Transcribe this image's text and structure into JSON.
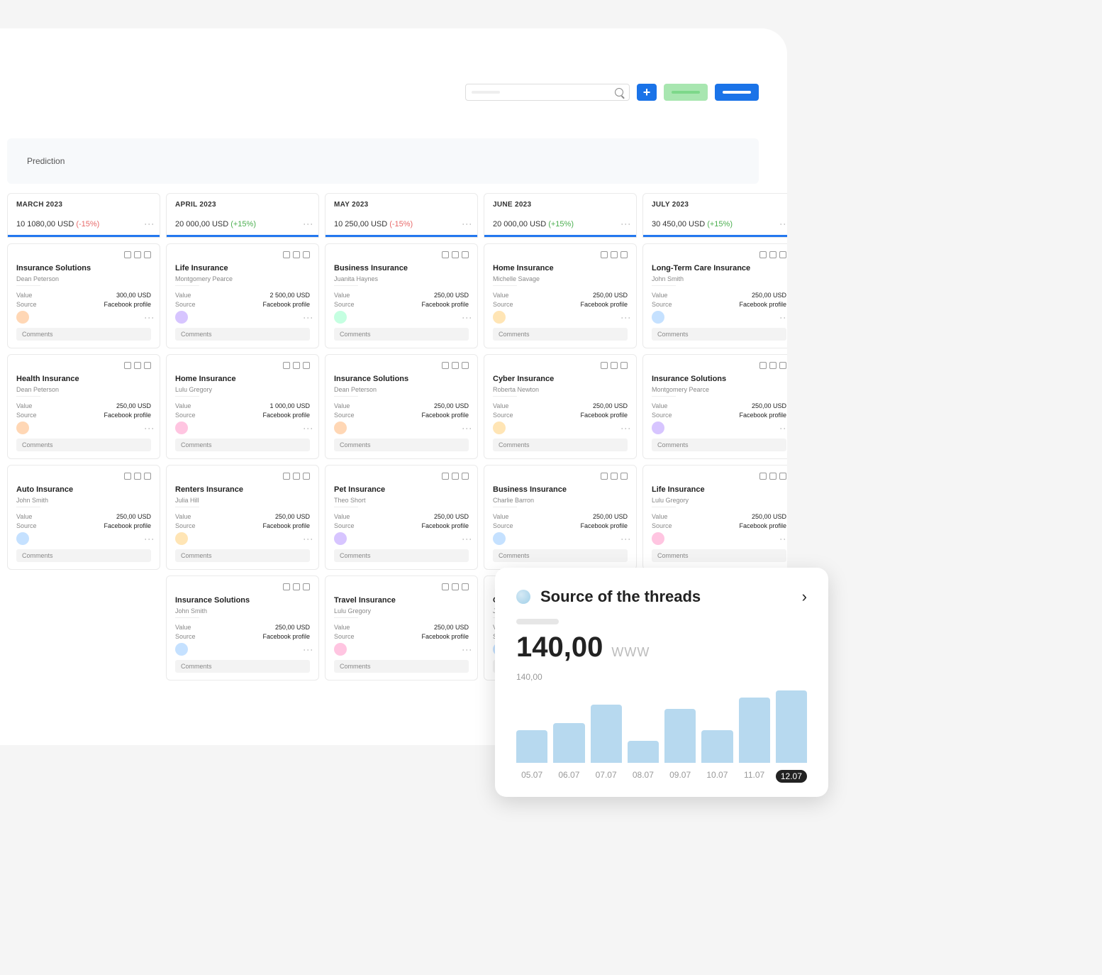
{
  "header": {
    "search_placeholder": "",
    "add_label": "+"
  },
  "tab": {
    "label": "Prediction"
  },
  "labels": {
    "value": "Value",
    "source": "Source",
    "comments": "Comments"
  },
  "columns": [
    {
      "month": "MARCH 2023",
      "amount": "10 1080,00 USD",
      "pct": "(-15%)",
      "pct_dir": "neg",
      "cards": [
        {
          "title": "Insurance Solutions",
          "person": "Dean Peterson",
          "value": "300,00 USD",
          "source": "Facebook profile",
          "avatar": "#ffd7b5"
        },
        {
          "title": "Health Insurance",
          "person": "Dean Peterson",
          "value": "250,00 USD",
          "source": "Facebook profile",
          "avatar": "#ffd7b5"
        },
        {
          "title": "Auto Insurance",
          "person": "John Smith",
          "value": "250,00 USD",
          "source": "Facebook profile",
          "avatar": "#c5e1ff"
        }
      ]
    },
    {
      "month": "APRIL 2023",
      "amount": "20 000,00 USD",
      "pct": "(+15%)",
      "pct_dir": "pos",
      "cards": [
        {
          "title": "Life Insurance",
          "person": "Montgomery Pearce",
          "value": "2 500,00 USD",
          "source": "Facebook profile",
          "avatar": "#d7c5ff"
        },
        {
          "title": "Home Insurance",
          "person": "Lulu Gregory",
          "value": "1 000,00 USD",
          "source": "Facebook profile",
          "avatar": "#ffc5e1"
        },
        {
          "title": "Renters Insurance",
          "person": "Julia Hill",
          "value": "250,00 USD",
          "source": "Facebook profile",
          "avatar": "#ffe5b5"
        },
        {
          "title": "Insurance Solutions",
          "person": "John Smith",
          "value": "250,00 USD",
          "source": "Facebook profile",
          "avatar": "#c5e1ff"
        }
      ]
    },
    {
      "month": "MAY 2023",
      "amount": "10 250,00 USD",
      "pct": "(-15%)",
      "pct_dir": "neg",
      "cards": [
        {
          "title": "Business Insurance",
          "person": "Juanita Haynes",
          "value": "250,00 USD",
          "source": "Facebook profile",
          "avatar": "#c5ffe1"
        },
        {
          "title": "Insurance Solutions",
          "person": "Dean Peterson",
          "value": "250,00 USD",
          "source": "Facebook profile",
          "avatar": "#ffd7b5"
        },
        {
          "title": "Pet Insurance",
          "person": "Theo Short",
          "value": "250,00 USD",
          "source": "Facebook profile",
          "avatar": "#d7c5ff"
        },
        {
          "title": "Travel Insurance",
          "person": "Lulu Gregory",
          "value": "250,00 USD",
          "source": "Facebook profile",
          "avatar": "#ffc5e1"
        }
      ]
    },
    {
      "month": "JUNE 2023",
      "amount": "20 000,00 USD",
      "pct": "(+15%)",
      "pct_dir": "pos",
      "cards": [
        {
          "title": "Home Insurance",
          "person": "Michelle Savage",
          "value": "250,00 USD",
          "source": "Facebook profile",
          "avatar": "#ffe5b5"
        },
        {
          "title": "Cyber Insurance",
          "person": "Roberta Newton",
          "value": "250,00 USD",
          "source": "Facebook profile",
          "avatar": "#ffe5b5"
        },
        {
          "title": "Business Insurance",
          "person": "Charlie Barron",
          "value": "250,00 USD",
          "source": "Facebook profile",
          "avatar": "#c5e1ff"
        },
        {
          "title": "Cyber Insurance",
          "person": "Julian",
          "value": "",
          "source": "",
          "avatar": "#c5e1ff"
        }
      ]
    },
    {
      "month": "JULY 2023",
      "amount": "30 450,00 USD",
      "pct": "(+15%)",
      "pct_dir": "pos",
      "cards": [
        {
          "title": "Long-Term Care Insurance",
          "person": "John Smith",
          "value": "250,00 USD",
          "source": "Facebook profile",
          "avatar": "#c5e1ff"
        },
        {
          "title": "Insurance Solutions",
          "person": "Montgomery Pearce",
          "value": "250,00 USD",
          "source": "Facebook profile",
          "avatar": "#d7c5ff"
        },
        {
          "title": "Life Insurance",
          "person": "Lulu Gregory",
          "value": "250,00 USD",
          "source": "Facebook profile",
          "avatar": "#ffc5e1"
        }
      ]
    }
  ],
  "overlay": {
    "title": "Source of the threads",
    "value": "140,00",
    "unit": "WWW",
    "yline": "140,00",
    "selected_index": 7
  },
  "chart_data": {
    "type": "bar",
    "categories": [
      "05.07",
      "06.07",
      "07.07",
      "08.07",
      "09.07",
      "10.07",
      "11.07",
      "12.07"
    ],
    "values": [
      45,
      55,
      80,
      30,
      75,
      45,
      90,
      100
    ],
    "title": "Source of the threads",
    "xlabel": "",
    "ylabel": "",
    "ylim": [
      0,
      140
    ]
  }
}
